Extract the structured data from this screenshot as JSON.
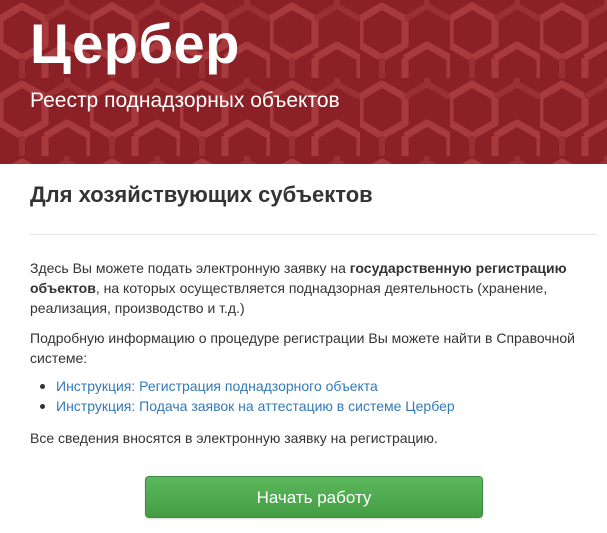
{
  "header": {
    "title": "Цербер",
    "subtitle": "Реестр поднадзорных объектов",
    "background_color": "#8b2126",
    "pattern_color": "#a4373b"
  },
  "main": {
    "heading": "Для хозяйствующих субъектов",
    "intro": {
      "part1": "Здесь Вы можете подать электронную заявку на ",
      "bold": "государственную регистрацию объектов",
      "part2": ", на которых осуществляется поднадзорная деятельность (хранение, реализация, производство и т.д.)"
    },
    "info_text": "Подробную информацию о процедуре регистрации Вы можете найти в Справочной системе:",
    "links": [
      {
        "label": "Инструкция: Регистрация поднадзорного объекта"
      },
      {
        "label": "Инструкция: Подача заявок на аттестацию в системе Цербер"
      }
    ],
    "note": "Все сведения вносятся в электронную заявку на регистрацию.",
    "start_button_label": "Начать работу",
    "link_color": "#337ab7",
    "button_color": "#5cb85c"
  }
}
